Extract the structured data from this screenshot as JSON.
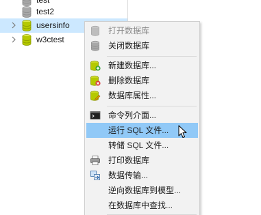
{
  "tree": {
    "items": [
      {
        "label": "test",
        "expandable": false
      },
      {
        "label": "test2",
        "expandable": false
      },
      {
        "label": "usersinfo",
        "expandable": true
      },
      {
        "label": "w3ctest",
        "expandable": true
      }
    ],
    "colors": {
      "selected_bg": "#cce8ff",
      "active_db": "#b5c900",
      "inactive_db": "#9e9e9e"
    }
  },
  "context_menu": {
    "items": [
      {
        "label": "打开数据库",
        "icon": "open-database-icon",
        "disabled": true
      },
      {
        "label": "关闭数据库",
        "icon": "close-database-icon",
        "disabled": false
      },
      {
        "label": "新建数据库...",
        "icon": "new-database-icon",
        "disabled": false
      },
      {
        "label": "删除数据库",
        "icon": "delete-database-icon",
        "disabled": false
      },
      {
        "label": "数据库属性...",
        "icon": "database-properties-icon",
        "disabled": false
      },
      {
        "label": "命令列介面...",
        "icon": "console-icon",
        "disabled": false
      },
      {
        "label": "运行 SQL 文件...",
        "icon": "",
        "disabled": false,
        "hover": true
      },
      {
        "label": "转储 SQL 文件...",
        "icon": "",
        "disabled": false
      },
      {
        "label": "打印数据库",
        "icon": "printer-icon",
        "disabled": false
      },
      {
        "label": "数据传输...",
        "icon": "data-transfer-icon",
        "disabled": false
      },
      {
        "label": "逆向数据库到模型...",
        "icon": "",
        "disabled": false
      },
      {
        "label": "在数据库中查找...",
        "icon": "",
        "disabled": false
      }
    ],
    "colors": {
      "background": "#f2f2f2",
      "hover_bg": "#91c9f7",
      "disabled_text": "#8a8a8a"
    }
  }
}
